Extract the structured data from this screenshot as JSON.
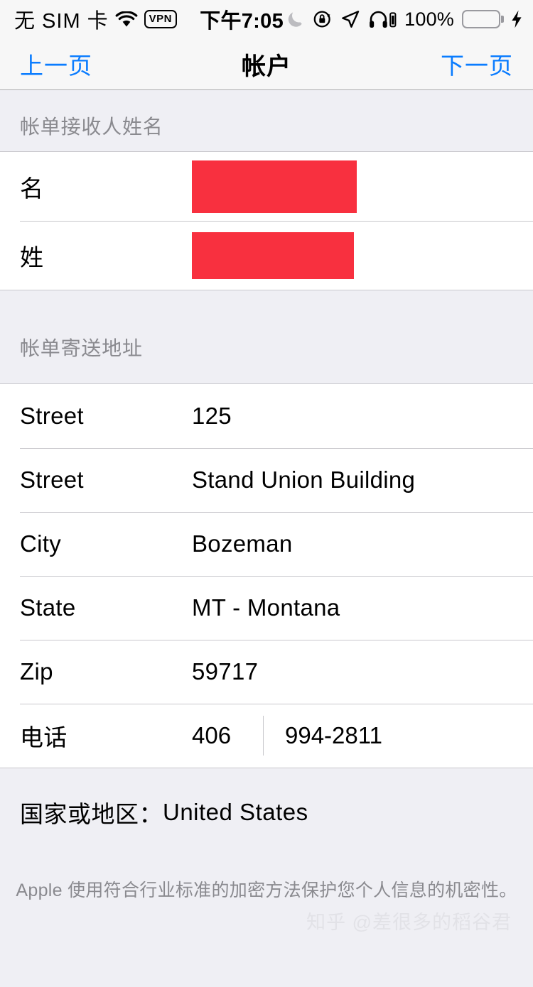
{
  "status_bar": {
    "carrier": "无 SIM 卡",
    "wifi_icon": "wifi-icon",
    "vpn_label": "VPN",
    "time": "下午7:05",
    "dnd_icon": "moon-icon",
    "rotation_lock_icon": "rotation-lock-icon",
    "location_icon": "location-arrow-icon",
    "headphones_icon": "headphones-battery-icon",
    "battery_percent": "100%",
    "battery_color": "#4CD964",
    "charging_icon": "lightning-bolt-icon"
  },
  "nav_bar": {
    "back_label": "上一页",
    "title": "帐户",
    "next_label": "下一页",
    "accent_color": "#0A7CFF"
  },
  "sections": {
    "name_section": {
      "header": "帐单接收人姓名",
      "rows": [
        {
          "label": "名",
          "value": "",
          "redacted": true
        },
        {
          "label": "姓",
          "value": "",
          "redacted": true
        }
      ],
      "redaction_color": "#F8303F"
    },
    "address_section": {
      "header": "帐单寄送地址",
      "rows": [
        {
          "label": "Street",
          "value": "125"
        },
        {
          "label": "Street",
          "value": "Stand Union Building"
        },
        {
          "label": "City",
          "value": "Bozeman"
        },
        {
          "label": "State",
          "value": "MT - Montana"
        },
        {
          "label": "Zip",
          "value": "59717"
        }
      ],
      "phone_row": {
        "label": "电话",
        "area_code": "406",
        "number": "994-2811"
      }
    }
  },
  "country": {
    "label": "国家或地区：",
    "value": "United States"
  },
  "footer": {
    "note": "Apple 使用符合行业标准的加密方法保护您个人信息的机密性。"
  },
  "watermark": {
    "text": "知乎 @差很多的稻谷君"
  }
}
